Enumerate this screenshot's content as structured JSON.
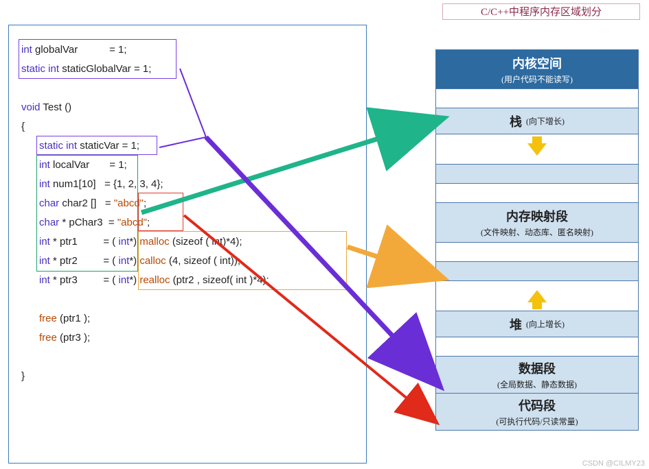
{
  "title": "C/C++中程序内存区域划分",
  "code": {
    "l1_int": "int",
    "l1_name": " globalVar",
    "l1_rest": "           = 1;",
    "l2_static": "static int",
    "l2_name": " staticGlobalVar",
    "l2_rest": " = 1;",
    "l3_void": "void",
    "l3_name": " Test ()",
    "l4": "{",
    "l5_static": "static int",
    "l5_name": " staticVar",
    "l5_rest": " = 1;",
    "l6_int": "int",
    "l6_name": " localVar",
    "l6_rest": "       = 1;",
    "l7_int": "int",
    "l7_name": " num1[10]",
    "l7_rest": "   = {1, 2, 3, 4};",
    "l8_char": "char",
    "l8_name": " char2 []",
    "l8_eq": "   = ",
    "l8_str": "\"abcd\"",
    "l8_semi": ";",
    "l9_char": "char",
    "l9_name": " * pChar3",
    "l9_eq": "  = ",
    "l9_str": "\"abcd\"",
    "l9_semi": ";",
    "l10_int": "int",
    "l10_name": " * ptr1",
    "l10_eq": "         = ( ",
    "l10_cast": "int",
    "l10_rest": "*) ",
    "l10_fn": "malloc",
    "l10_args": " (sizeof ( int)*4);",
    "l11_int": "int",
    "l11_name": " * ptr2",
    "l11_eq": "         = ( ",
    "l11_cast": "int",
    "l11_rest": "*) ",
    "l11_fn": "calloc",
    "l11_args": " (4, sizeof ( int));",
    "l12_int": "int",
    "l12_name": " * ptr3",
    "l12_eq": "         = ( ",
    "l12_cast": "int",
    "l12_rest": "*) ",
    "l12_fn": "realloc",
    "l12_args": " (ptr2 , sizeof( int )*4);",
    "l13_fn": "free",
    "l13_args": " (ptr1 );",
    "l14_fn": "free",
    "l14_args": " (ptr3 );",
    "l15": "}"
  },
  "mem": {
    "kernel": {
      "main": "内核空间",
      "sub": "(用户代码不能读写)"
    },
    "stack": {
      "main": "栈",
      "sub": "(向下增长)"
    },
    "mmap": {
      "main": "内存映射段",
      "sub": "(文件映射、动态库、匿名映射)"
    },
    "heap": {
      "main": "堆",
      "sub": "(向上增长)"
    },
    "data": {
      "main": "数据段",
      "sub": "(全局数据、静态数据)"
    },
    "code": {
      "main": "代码段",
      "sub": "(可执行代码/只读常量)"
    }
  },
  "watermark": "CSDN @CILMY23"
}
